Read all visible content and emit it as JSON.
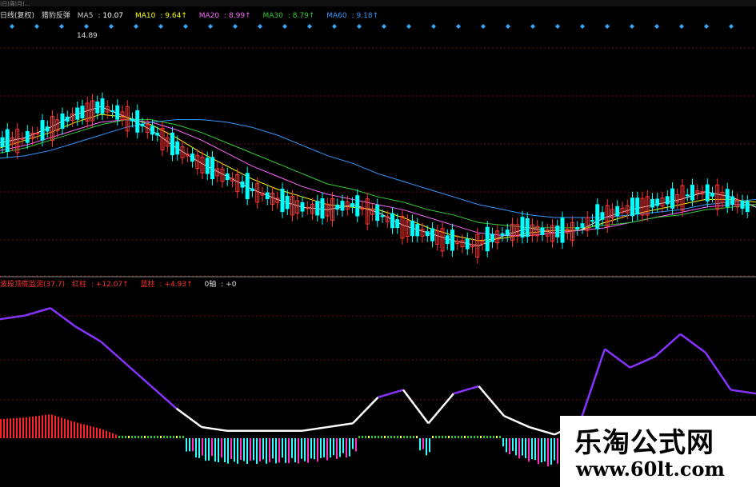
{
  "toolbar_text": "|日|周|月|…",
  "header": {
    "period_label": "日线(复权)",
    "indicator_name": "猎豹反弹",
    "ma": [
      {
        "label": "MA5",
        "value": "10.07",
        "color": "#ffffff"
      },
      {
        "label": "MA10",
        "value": "9.64↑",
        "color": "#ffff00"
      },
      {
        "label": "MA20",
        "value": "8.99↑",
        "color": "#ff66ff"
      },
      {
        "label": "MA30",
        "value": "8.79↑",
        "color": "#33cc33"
      },
      {
        "label": "MA60",
        "value": "9.18↑",
        "color": "#3399ff"
      }
    ]
  },
  "high_label": "14.89",
  "lower_header": {
    "title": "波段顶底监测(37.7)",
    "red_label": "红柱",
    "red_value": "+12.07↑",
    "cyan_label": "蓝柱",
    "cyan_value": "+4.93↑",
    "zero_label": "0轴",
    "zero_value": "+0"
  },
  "watermark": {
    "title": "乐淘公式网",
    "url": "www.60lt.com"
  },
  "colors": {
    "up": "#ff3333",
    "down": "#00ffff",
    "ma5": "#ffffff",
    "ma10": "#ffff00",
    "ma20": "#ff66ff",
    "ma30": "#33cc33",
    "ma60": "#3399ff",
    "osc_hi": "#8833ff",
    "osc_lo": "#ffffff",
    "bar_red": "#ff2222",
    "bar_cyan": "#33ffff",
    "bar_pink": "#ff33cc",
    "bar_yellow": "#ffff33",
    "bar_green": "#33cc33",
    "grid": "#661111",
    "diamond": "#33aaff"
  },
  "chart_data": [
    {
      "type": "line",
      "kind": "candlestick_with_moving_averages",
      "series": [
        {
          "name": "MA5",
          "values": [
            11.2,
            11.4,
            11.8,
            12.3,
            12.6,
            12.2,
            11.7,
            11.0,
            10.4,
            9.9,
            9.4,
            9.0,
            8.7,
            8.6,
            8.8,
            8.5,
            8.0,
            7.7,
            7.4,
            7.2,
            7.6,
            7.9,
            7.7,
            7.8,
            8.3,
            8.6,
            8.8,
            9.0,
            9.3,
            9.1,
            8.7
          ]
        },
        {
          "name": "MA10",
          "values": [
            11.0,
            11.3,
            11.6,
            12.0,
            12.3,
            12.2,
            11.9,
            11.4,
            10.8,
            10.3,
            9.8,
            9.4,
            9.1,
            8.8,
            8.7,
            8.6,
            8.3,
            7.9,
            7.6,
            7.4,
            7.5,
            7.7,
            7.8,
            7.8,
            8.1,
            8.4,
            8.6,
            8.8,
            9.0,
            9.0,
            8.9
          ]
        },
        {
          "name": "MA20",
          "values": [
            10.9,
            11.1,
            11.4,
            11.7,
            12.0,
            12.1,
            12.0,
            11.7,
            11.3,
            10.8,
            10.3,
            9.9,
            9.5,
            9.2,
            9.0,
            8.8,
            8.6,
            8.3,
            8.0,
            7.7,
            7.6,
            7.6,
            7.7,
            7.8,
            7.9,
            8.1,
            8.3,
            8.5,
            8.7,
            8.8,
            8.8
          ]
        },
        {
          "name": "MA30",
          "values": [
            10.8,
            11.0,
            11.3,
            11.6,
            11.9,
            12.1,
            12.1,
            11.9,
            11.6,
            11.2,
            10.8,
            10.4,
            10.0,
            9.6,
            9.4,
            9.1,
            8.9,
            8.6,
            8.4,
            8.1,
            8.0,
            7.9,
            7.9,
            7.9,
            8.0,
            8.1,
            8.3,
            8.4,
            8.6,
            8.7,
            8.8
          ]
        },
        {
          "name": "MA60",
          "values": [
            10.6,
            10.7,
            10.9,
            11.2,
            11.5,
            11.8,
            12.0,
            12.1,
            12.1,
            12.0,
            11.8,
            11.5,
            11.1,
            10.7,
            10.4,
            10.0,
            9.7,
            9.4,
            9.1,
            8.8,
            8.6,
            8.4,
            8.3,
            8.3,
            8.3,
            8.4,
            8.5,
            8.6,
            8.8,
            8.9,
            9.0
          ]
        }
      ],
      "ylim": [
        6.5,
        15.5
      ],
      "annotations": [
        "14.89"
      ]
    },
    {
      "type": "line",
      "kind": "oscillator_with_histogram",
      "series": [
        {
          "name": "",
          "values": [
            32,
            33,
            35,
            30,
            26,
            20,
            14,
            8,
            3,
            2,
            2,
            2,
            2,
            3,
            4,
            11,
            13,
            4,
            12,
            14,
            6,
            3,
            1,
            4,
            24,
            19,
            22,
            28,
            23,
            13,
            12
          ]
        }
      ],
      "ylim": [
        0,
        40
      ]
    }
  ]
}
